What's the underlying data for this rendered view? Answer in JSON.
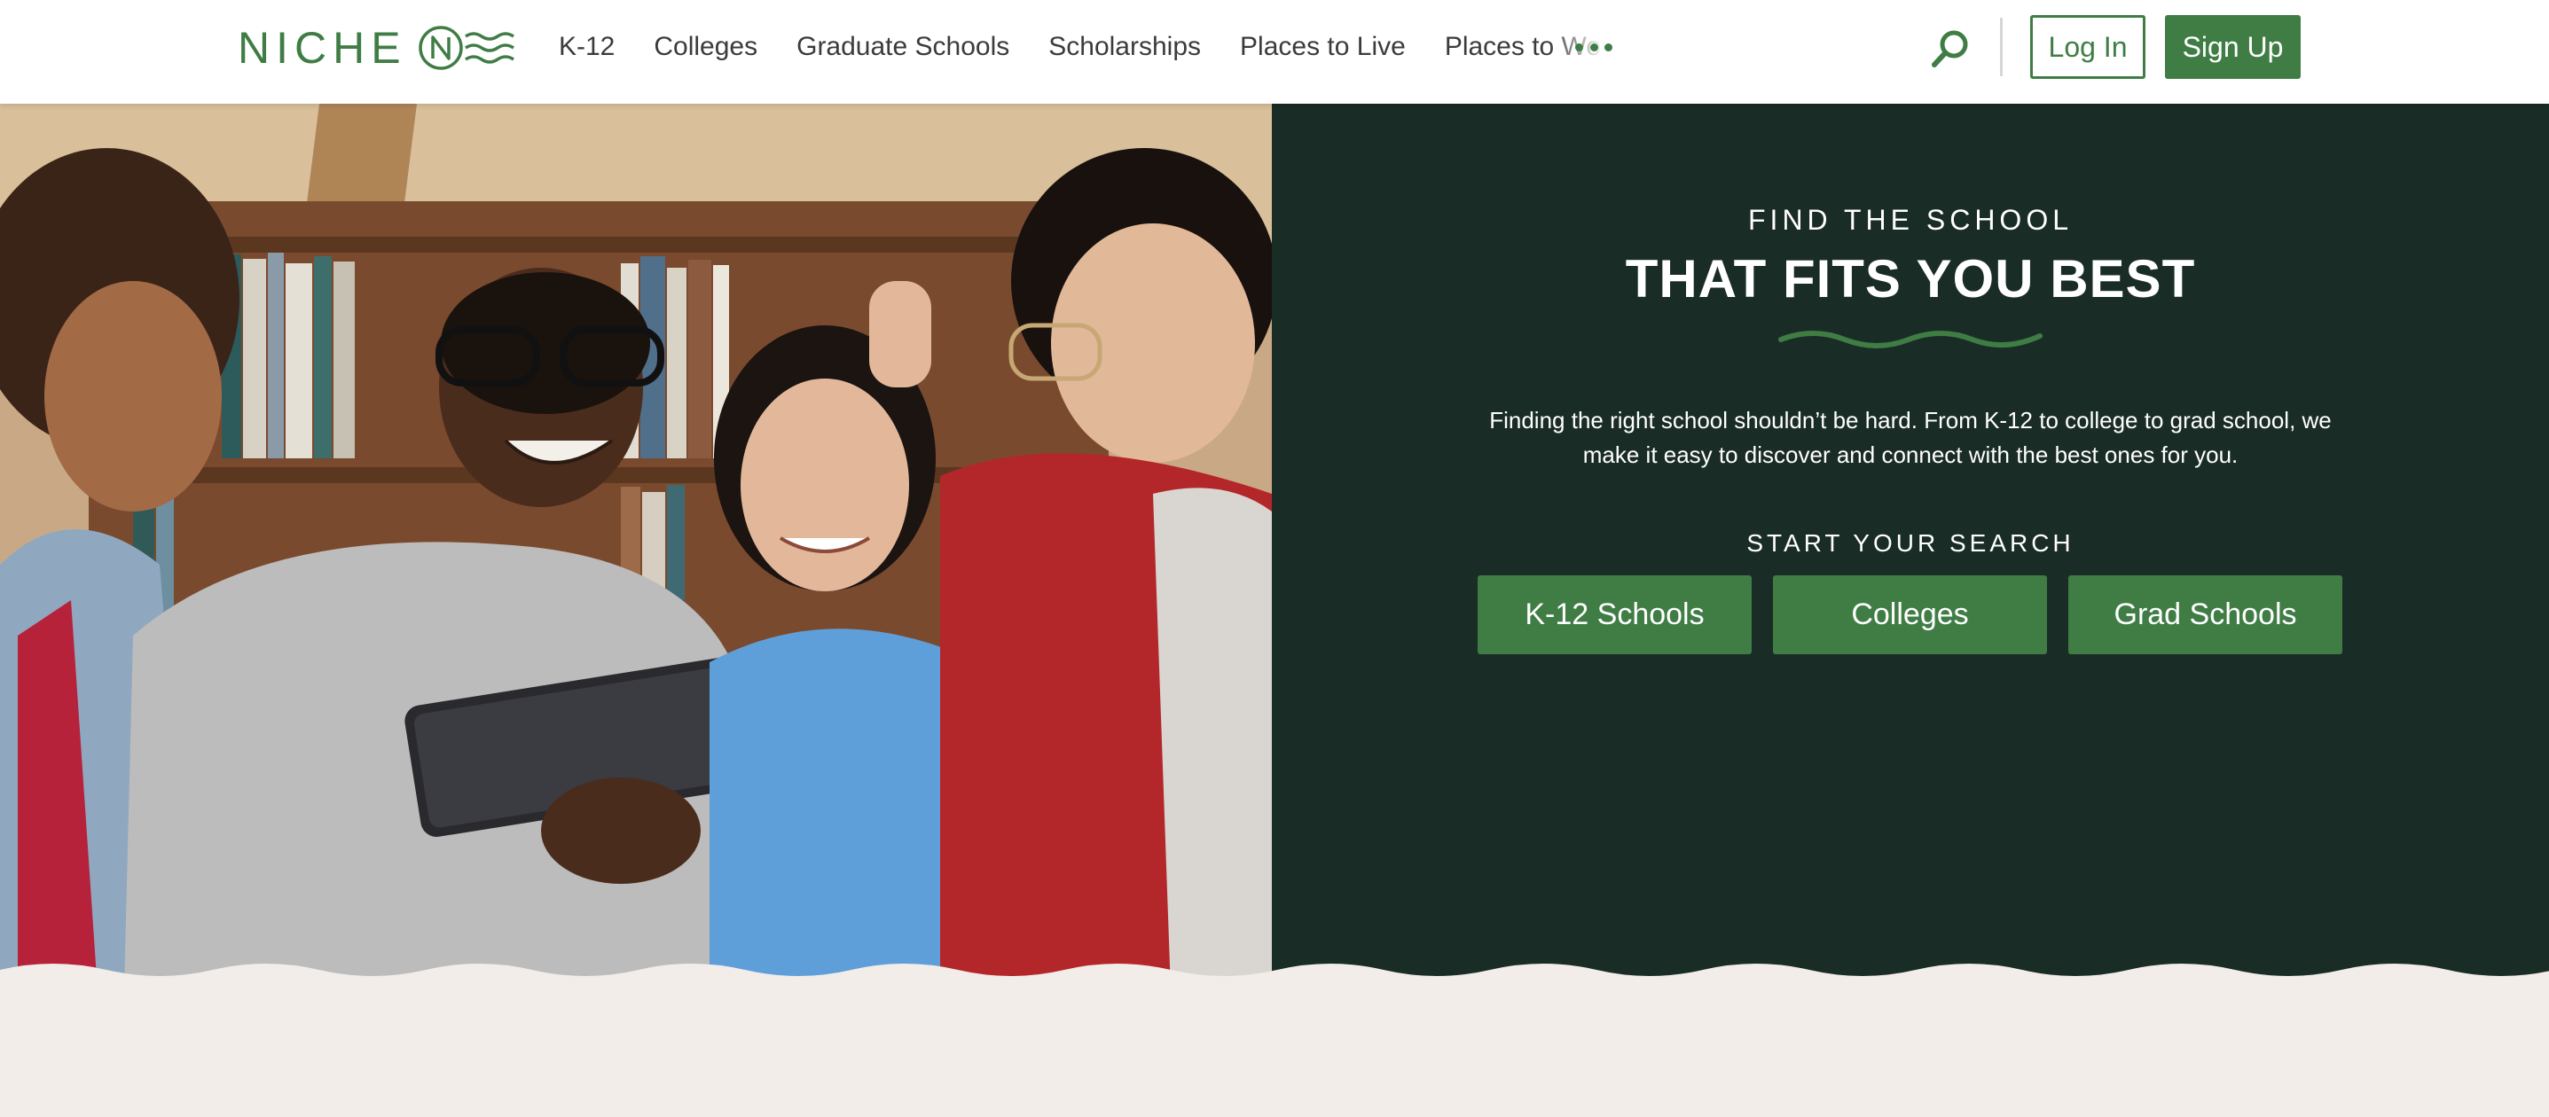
{
  "header": {
    "logo_text": "NICHE",
    "logo_icon": "niche-wave-logo",
    "nav": [
      "K-12",
      "Colleges",
      "Graduate Schools",
      "Scholarships",
      "Places to Live",
      "Places to Work"
    ],
    "more_icon": "more-dots-icon",
    "search_icon": "search-icon",
    "login_label": "Log In",
    "signup_label": "Sign Up"
  },
  "hero": {
    "photo_alt": "Four students smiling at a tablet in front of a bookshelf",
    "kicker": "FIND THE SCHOOL",
    "headline": "THAT FITS YOU BEST",
    "intro": "Finding the right school shouldn’t be hard. From K-12 to college to grad school, we make it easy to discover and connect with the best ones for you.",
    "search_label": "START YOUR SEARCH",
    "buttons": [
      "K-12 Schools",
      "Colleges",
      "Grad Schools"
    ]
  },
  "colors": {
    "brand_green": "#3f7d45",
    "panel_dark": "#1a2c26",
    "cream": "#f3ede9",
    "nav_text": "#3b3b3b"
  }
}
